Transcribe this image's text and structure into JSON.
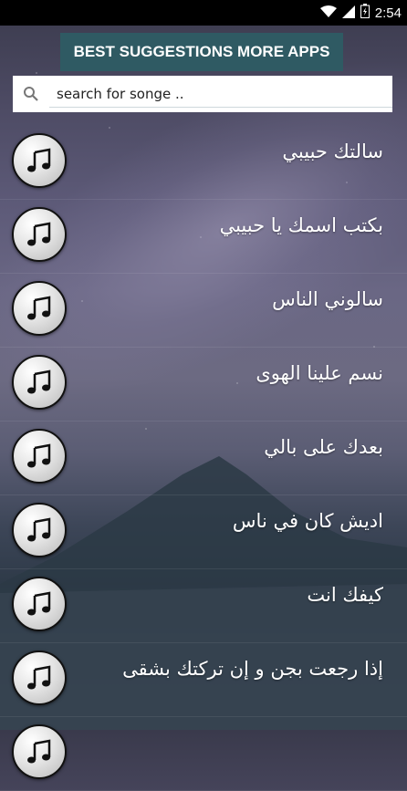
{
  "status_bar": {
    "time": "2:54",
    "icons": [
      "wifi-icon",
      "signal-icon",
      "battery-charging-icon"
    ]
  },
  "banner": {
    "label": "BEST SUGGESTIONS MORE APPS"
  },
  "search": {
    "placeholder": "search for songe ..",
    "icon": "search-icon"
  },
  "songs": [
    {
      "title": "سالتك حبيبي",
      "icon": "music-note-icon"
    },
    {
      "title": "بكتب اسمك يا حبيبي",
      "icon": "music-note-icon"
    },
    {
      "title": "سالوني الناس",
      "icon": "music-note-icon"
    },
    {
      "title": "نسم علينا الهوى",
      "icon": "music-note-icon"
    },
    {
      "title": "بعدك على بالي",
      "icon": "music-note-icon"
    },
    {
      "title": "اديش كان في ناس",
      "icon": "music-note-icon"
    },
    {
      "title": "كيفك انت",
      "icon": "music-note-icon"
    },
    {
      "title": "إذا رجعت بجن و إن تركتك بشقى",
      "icon": "music-note-icon"
    },
    {
      "title": "",
      "icon": "music-note-icon"
    }
  ],
  "colors": {
    "banner": "#2f5a63",
    "status_bar": "#000000",
    "search_bg": "#ffffff"
  }
}
